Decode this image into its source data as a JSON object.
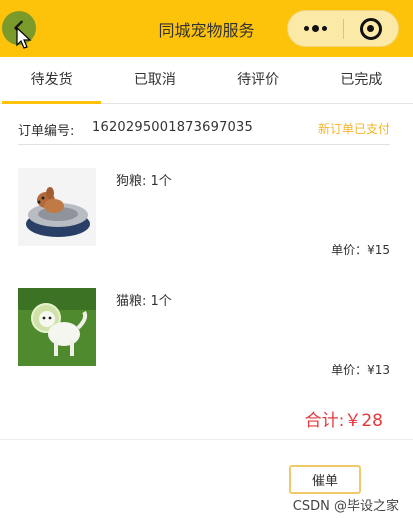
{
  "navbar": {
    "title": "同城宠物服务",
    "back_icon": "chevron-left-icon",
    "menu_icon": "more-dots-icon",
    "close_icon": "target-circle-icon"
  },
  "tabs": [
    {
      "label": "待发货",
      "active": true
    },
    {
      "label": "已取消",
      "active": false
    },
    {
      "label": "待评价",
      "active": false
    },
    {
      "label": "已完成",
      "active": false
    }
  ],
  "order": {
    "number_label": "订单编号:",
    "number": "1620295001873697035",
    "status": "新订单已支付",
    "items": [
      {
        "name": "狗粮: 1个",
        "price": "单价：¥15"
      },
      {
        "name": "猫粮: 1个",
        "price": "单价：¥13"
      }
    ],
    "total": "合计:￥28"
  },
  "actions": {
    "urge_label": "催单"
  },
  "watermark": "CSDN @毕设之家",
  "colors": {
    "accent": "#fcc30a",
    "total": "#e4393c",
    "status": "#f3b52a"
  }
}
